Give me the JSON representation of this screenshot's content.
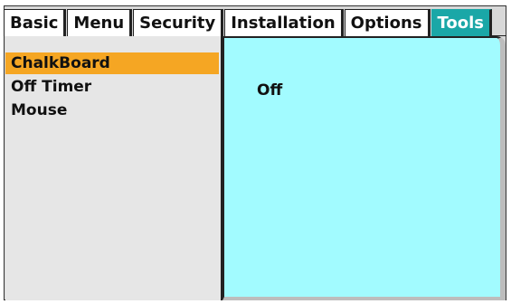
{
  "tabs": [
    {
      "label": "Basic"
    },
    {
      "label": "Menu"
    },
    {
      "label": "Security"
    },
    {
      "label": "Installation"
    },
    {
      "label": "Options"
    },
    {
      "label": "Tools",
      "active": true
    }
  ],
  "menu": {
    "items": [
      {
        "label": "ChalkBoard",
        "selected": true
      },
      {
        "label": "Off Timer"
      },
      {
        "label": "Mouse"
      }
    ]
  },
  "detail": {
    "value": "Off"
  },
  "colors": {
    "active_tab": "#1aa7a7",
    "selected_item": "#f5a623",
    "detail_bg": "#a2fbff"
  }
}
